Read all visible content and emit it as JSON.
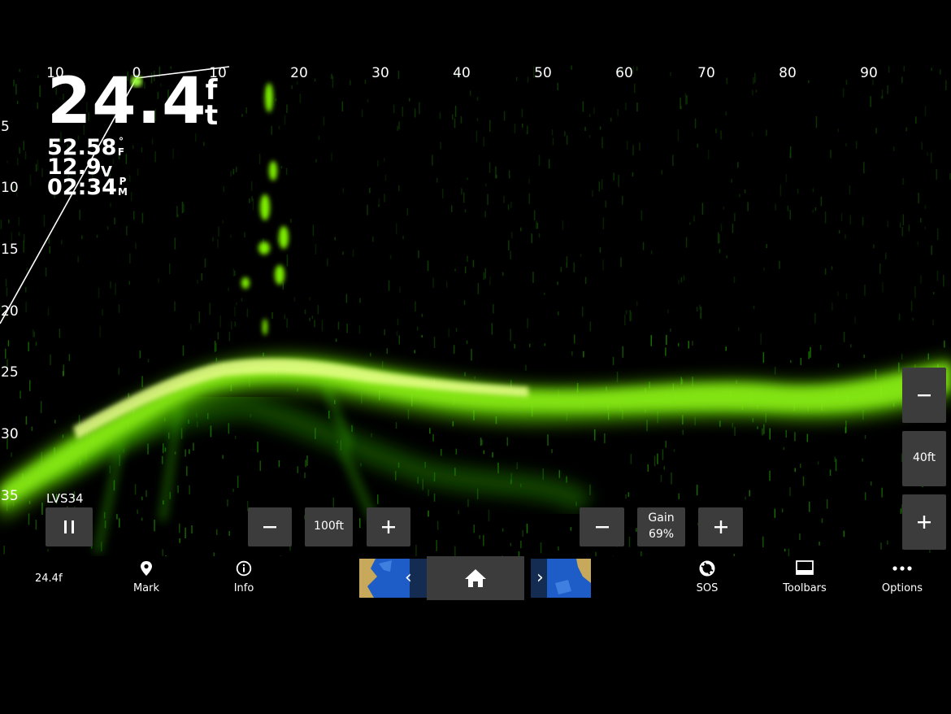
{
  "scale": {
    "x_ticks": [
      "10",
      "0",
      "10",
      "20",
      "30",
      "40",
      "50",
      "60",
      "70",
      "80",
      "90"
    ],
    "y_ticks": [
      "5",
      "10",
      "15",
      "20",
      "25",
      "30",
      "35"
    ]
  },
  "readouts": {
    "depth": "24.4",
    "depth_unit_top": "f",
    "depth_unit_bottom": "t",
    "water_temp": "52.58",
    "water_temp_unit_top": "°",
    "water_temp_unit_bottom": "F",
    "voltage": "12.9",
    "voltage_unit": "V",
    "time": "02:34",
    "time_unit_top": "P",
    "time_unit_bottom": "M"
  },
  "source": {
    "transducer_label": "LVS34",
    "pause_icon": "pause-icon"
  },
  "range": {
    "value": "100ft",
    "minus_icon": "minus-icon",
    "plus_icon": "plus-icon"
  },
  "gain": {
    "label": "Gain",
    "value": "69%",
    "minus_icon": "minus-icon",
    "plus_icon": "plus-icon"
  },
  "zoom": {
    "value": "40ft",
    "minus_icon": "minus-icon",
    "plus_icon": "plus-icon"
  },
  "bottom_bar": {
    "depth_short": "24.4ft",
    "mark_label": "Mark",
    "mark_icon": "map-pin-icon",
    "info_label": "Info",
    "info_icon": "info-icon",
    "home_icon": "home-icon",
    "sos_label": "SOS",
    "sos_icon": "lifebuoy-icon",
    "toolbars_label": "Toolbars",
    "toolbars_icon": "toolbar-icon",
    "options_label": "Options",
    "options_icon": "more-dots-icon",
    "prev_icon": "chevron-left-icon",
    "next_icon": "chevron-right-icon"
  },
  "colors": {
    "sonar_bright": "#e8ff8a",
    "sonar_mid": "#7cf000",
    "sonar_dim": "#1f7a00",
    "control_bg": "#3c3c3c"
  }
}
